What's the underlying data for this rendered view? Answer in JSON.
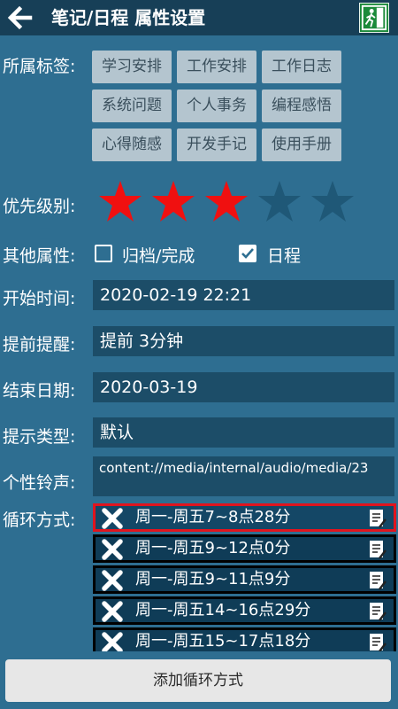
{
  "header": {
    "title": "笔记/日程 属性设置",
    "back_icon": "arrow-left-icon",
    "exit_icon": "exit-door-icon"
  },
  "labels": {
    "tags": "所属标签:",
    "priority": "优先级别:",
    "other": "其他属性:",
    "start_time": "开始时间:",
    "remind": "提前提醒:",
    "end_date": "结束日期:",
    "hint_type": "提示类型:",
    "ringtone": "个性铃声:",
    "cycle": "循环方式:"
  },
  "tags": [
    "学习安排",
    "工作安排",
    "工作日志",
    "系统问题",
    "个人事务",
    "编程感悟",
    "心得随感",
    "开发手记",
    "使用手册"
  ],
  "priority": {
    "value": 3,
    "max": 5,
    "active_color": "#f01010",
    "inactive_color": "#1f5877"
  },
  "other_attrs": [
    {
      "label": "归档/完成",
      "checked": false
    },
    {
      "label": "日程",
      "checked": true
    }
  ],
  "fields": {
    "start_time": "2020-02-19 22:21",
    "remind": "提前 3分钟",
    "end_date": "2020-03-19",
    "hint_type": "默认",
    "ringtone": "content://media/internal/audio/media/23"
  },
  "cycles": [
    {
      "text": "周一-周五7~8点28分",
      "selected": true
    },
    {
      "text": "周一-周五9~12点0分",
      "selected": false
    },
    {
      "text": "周一-周五9~11点9分",
      "selected": false
    },
    {
      "text": "周一-周五14~16点29分",
      "selected": false
    },
    {
      "text": "周一-周五15~17点18分",
      "selected": false
    }
  ],
  "add_button": "添加循环方式",
  "colors": {
    "background": "#2e6e91",
    "header": "#173f57",
    "field": "#1c4d68",
    "selected_border": "#e0141e"
  }
}
